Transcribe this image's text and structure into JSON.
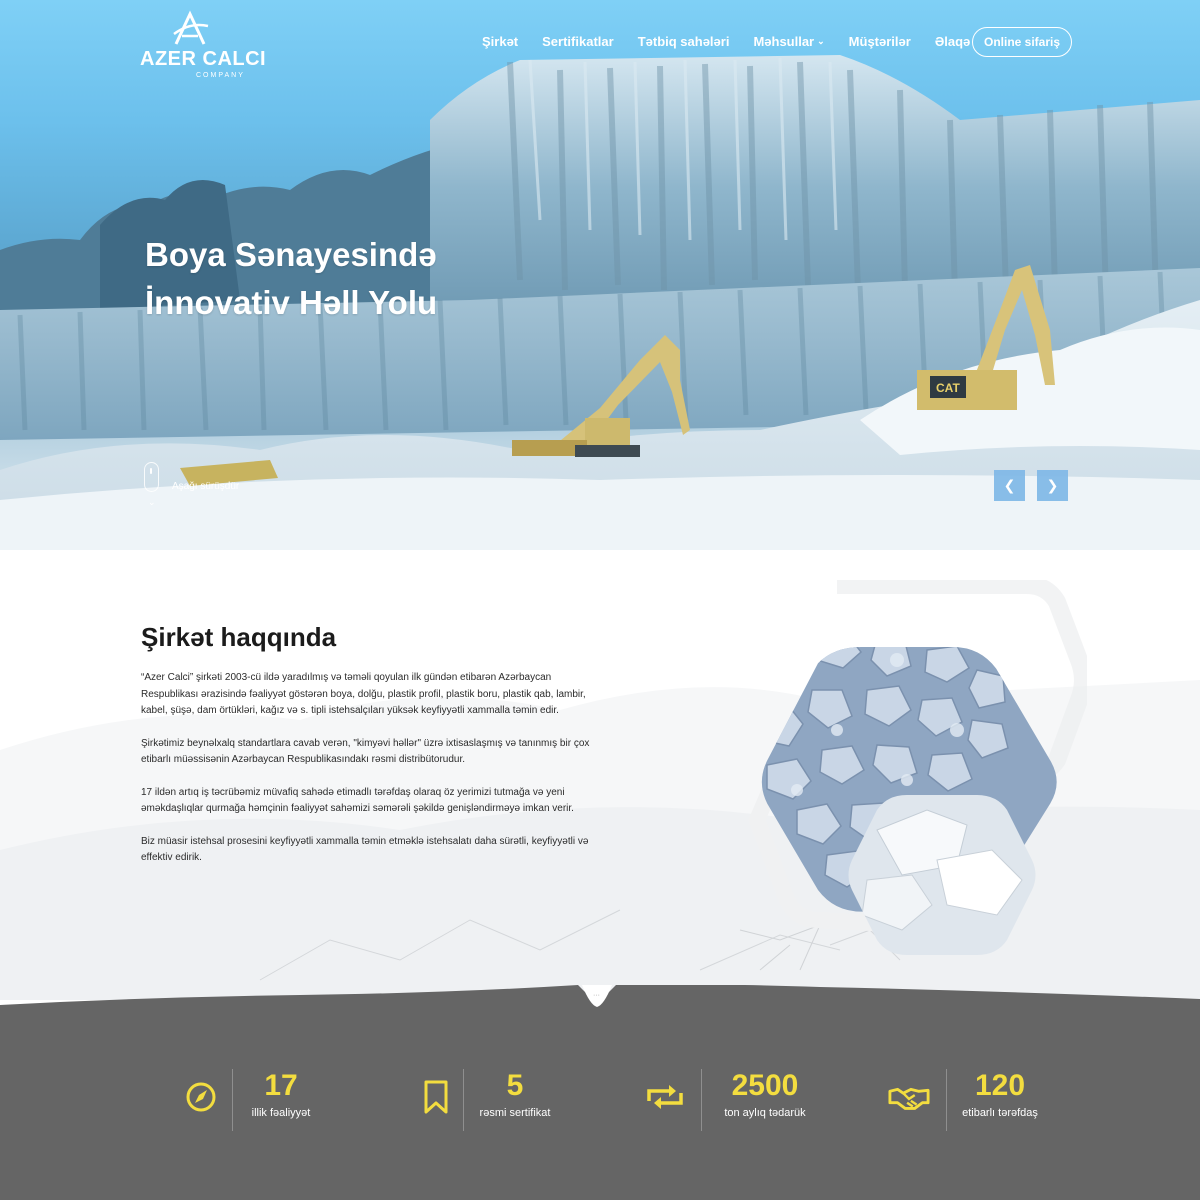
{
  "brand": {
    "name": "AZER CALCI",
    "subtitle": "COMPANY"
  },
  "nav": {
    "items": [
      "Şirkət",
      "Sertifikatlar",
      "Tətbiq sahələri",
      "Məhsullar",
      "Müştərilər",
      "Əlaqə"
    ],
    "order_button": "Online sifariş"
  },
  "hero": {
    "title_line1": "Boya Sənayesində",
    "title_line2": "İnnovativ Həll Yolu",
    "scroll_label": "Aşağı sürüşdür",
    "machine_label": "CAT"
  },
  "about": {
    "title": "Şirkət haqqında",
    "paragraphs": [
      "“Azer Calci” şirkəti 2003-cü ildə yaradılmış və təməli qoyulan ilk gündən etibarən Azərbaycan Respublikası ərazisində fəaliyyət göstərən boya, dolğu, plastik profil, plastik boru, plastik qab, lambir, kabel, şüşə, dam örtükləri, kağız və s. tipli istehsalçıları yüksək keyfiyyətli xammalla təmin edir.",
      "Şirkətimiz beynəlxalq standartlara cavab verən, \"kimyəvi həllər\" üzrə ixtisaslaşmış və tanınmış bir çox etibarlı müəssisənin Azərbaycan Respublikasındakı rəsmi distribütorudur.",
      "17 ildən artıq iş təcrübəmiz müvafiq sahədə etimadlı tərəfdaş olaraq öz yerimizi tutmağa və yeni əməkdaşlıqlar qurmağa həmçinin fəaliyyət sahəmizi səmərəli şəkildə genişləndirməyə imkan verir.",
      "Biz müasir istehsal prosesini keyfiyyətli xammalla təmin etməklə istehsalatı daha sürətli, keyfiyyətli və effektiv edirik."
    ]
  },
  "stats": [
    {
      "icon": "compass-icon",
      "value": "17",
      "label": "illik fəaliyyət"
    },
    {
      "icon": "bookmark-icon",
      "value": "5",
      "label": "rəsmi sertifikat"
    },
    {
      "icon": "repeat-icon",
      "value": "2500",
      "label": "ton aylıq tədarük"
    },
    {
      "icon": "handshake-icon",
      "value": "120",
      "label": "etibarlı tərəfdaş"
    }
  ],
  "colors": {
    "accent": "#f3dd3f",
    "stats_bg": "#656565",
    "slider_button": "#7fb7e6"
  }
}
